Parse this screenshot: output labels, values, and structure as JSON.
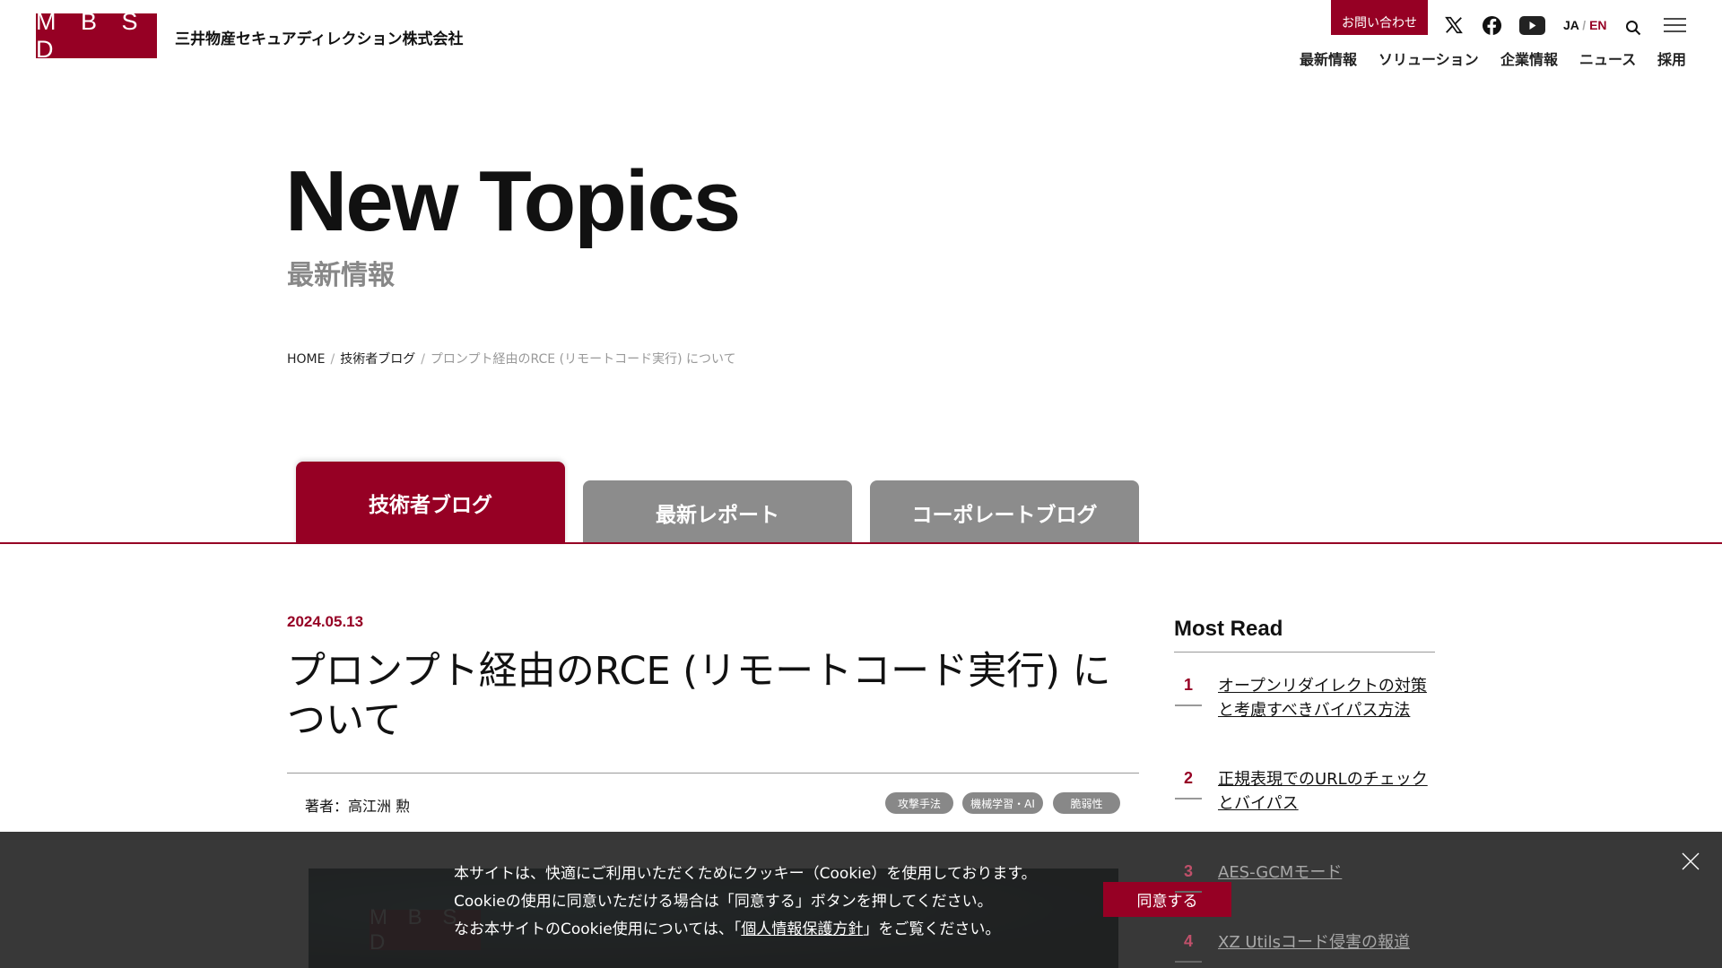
{
  "header": {
    "logo_text": "M B S D",
    "company_name": "三井物産セキュアディレクション株式会社",
    "contact_label": "お問い合わせ",
    "social_icons": [
      "x-icon",
      "facebook-icon",
      "youtube-icon"
    ],
    "lang_ja": "JA",
    "lang_sep": "/",
    "lang_en": "EN",
    "nav": [
      "最新情報",
      "ソリューション",
      "企業情報",
      "ニュース",
      "採用"
    ]
  },
  "hero": {
    "title": "New Topics",
    "subtitle": "最新情報"
  },
  "breadcrumb": {
    "home": "HOME",
    "sep": "/",
    "section": "技術者ブログ",
    "current": "プロンプト経由のRCE (リモートコード実行) について"
  },
  "tabs": [
    {
      "label": "技術者ブログ",
      "active": true
    },
    {
      "label": "最新レポート",
      "active": false
    },
    {
      "label": "コーポレートブログ",
      "active": false
    }
  ],
  "article": {
    "date": "2024.05.13",
    "title": "プロンプト経由のRCE (リモートコード実行) について",
    "author": "著者：高江洲 勲",
    "tags": [
      "攻撃手法",
      "機械学習・AI",
      "脆弱性"
    ]
  },
  "sidebar": {
    "title": "Most Read",
    "items": [
      {
        "num": "1",
        "text": "オープンリダイレクトの対策と考慮すべきバイパス方法"
      },
      {
        "num": "2",
        "text": "正規表現でのURLのチェックとバイパス"
      },
      {
        "num": "3",
        "text": "AES-GCMモード"
      },
      {
        "num": "4",
        "text": "XZ Utilsコード侵害の報道"
      }
    ]
  },
  "cookie": {
    "line1": "本サイトは、快適にご利用いただくためにクッキー（Cookie）を使用しております。",
    "line2": "Cookieの使用に同意いただける場合は「同意する」ボタンを押してください。",
    "line3_pre": "なお本サイトのCookie使用については、「",
    "line3_link": "個人情報保護方針",
    "line3_post": "」をご覧ください。",
    "agree_label": "同意する",
    "close_glyph": "╳"
  },
  "colors": {
    "brand": "#960024",
    "tab_inactive": "#8c8c8c",
    "cookie_bg": "#222222"
  }
}
